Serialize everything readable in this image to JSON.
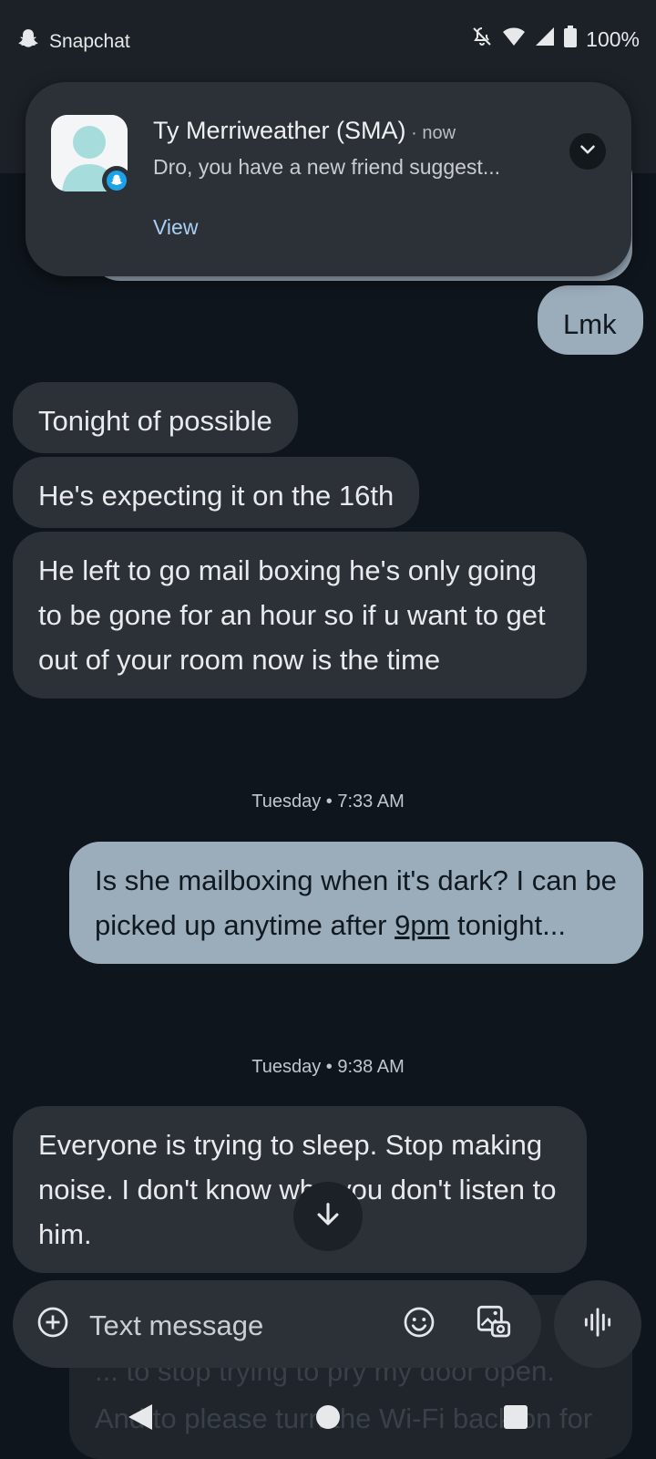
{
  "status_bar": {
    "app_name": "Snapchat",
    "app_icon": "snapchat-ghost-icon",
    "battery": "100%",
    "icons": [
      "notifications-muted-icon",
      "wifi-icon",
      "cell-signal-icon",
      "battery-icon"
    ]
  },
  "notification": {
    "sender": "Ty Merriweather (SMA)",
    "time": "now",
    "body": "Dro, you have a new friend suggest...",
    "action": "View",
    "avatar_icon": "default-avatar-icon",
    "badge_icon": "snapchat-ghost-icon",
    "expand_icon": "chevron-down-icon"
  },
  "messages": [
    {
      "id": "m0",
      "dir": "out",
      "text": "Lmk"
    },
    {
      "id": "m1",
      "dir": "in",
      "text": "Tonight of possible"
    },
    {
      "id": "m2",
      "dir": "in",
      "text": "He's expecting it on the 16th"
    },
    {
      "id": "m3",
      "dir": "in",
      "text": "He left to go mail boxing he's only going to be gone for an hour so if u want to get out of your room now is the time"
    },
    {
      "id": "m4",
      "dir": "out",
      "text_before": "Is she mailboxing when it's dark? I can be picked up anytime after ",
      "link": "9pm",
      "text_after": " tonight..."
    },
    {
      "id": "m5",
      "dir": "in",
      "text": "Everyone is trying to sleep. Stop making noise. I don't know why you don't listen to him."
    }
  ],
  "timestamps": [
    "Tuesday • 7:33 AM",
    "Tuesday • 9:38 AM"
  ],
  "partial_message": "... to stop trying to pry my door open. And to please turn the Wi-Fi back on for my",
  "composer": {
    "placeholder": "Text message",
    "add_icon": "add-circle-icon",
    "emoji_icon": "emoji-icon",
    "gallery_icon": "image-gallery-icon",
    "voice_icon": "voice-wave-icon"
  },
  "scroll_icon": "arrow-down-icon",
  "nav": [
    "back-icon",
    "home-icon",
    "recents-icon"
  ]
}
